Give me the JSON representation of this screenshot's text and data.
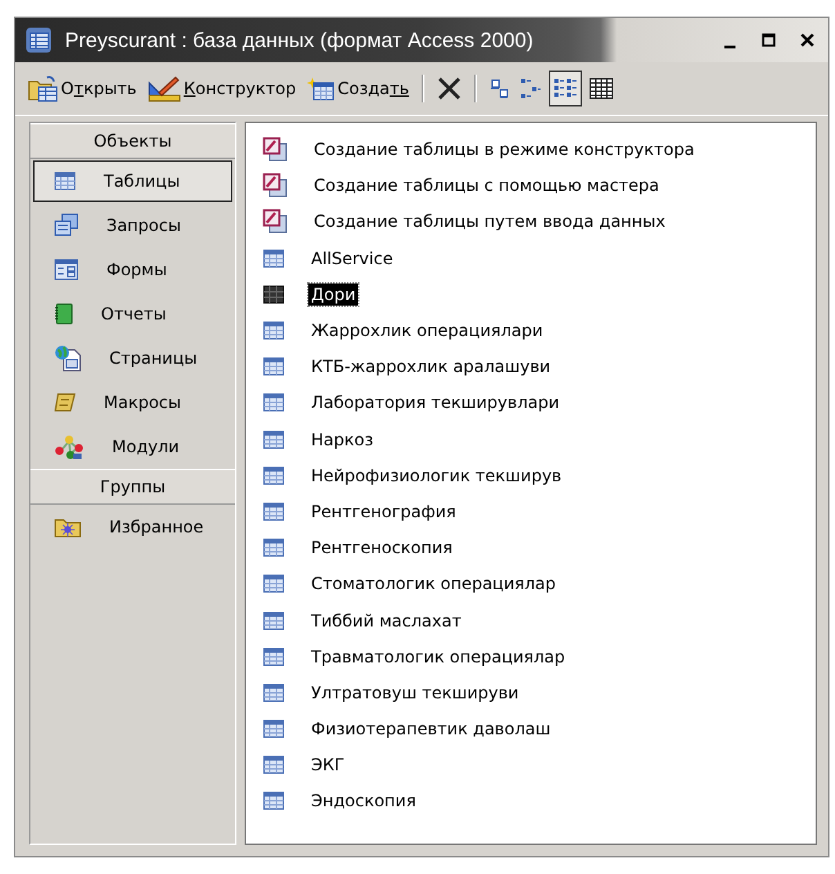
{
  "window": {
    "title": "Preyscurant : база данных (формат Access 2000)"
  },
  "toolbar": {
    "commands": [
      {
        "kind": "open",
        "before": "О",
        "accel": "т",
        "after": "крыть"
      },
      {
        "kind": "design",
        "accel": "К",
        "after": "онструктор"
      },
      {
        "kind": "new",
        "before": "Созда",
        "accel": "ть"
      }
    ],
    "views": [
      {
        "kind": "large",
        "selected": false
      },
      {
        "kind": "small",
        "selected": false
      },
      {
        "kind": "list",
        "selected": true
      },
      {
        "kind": "details",
        "selected": false
      }
    ]
  },
  "sidebar": {
    "sections": [
      {
        "title": "Объекты",
        "items": [
          {
            "kind": "table",
            "label": "Таблицы",
            "selected": true
          },
          {
            "kind": "query",
            "label": "Запросы",
            "selected": false
          },
          {
            "kind": "form",
            "label": "Формы",
            "selected": false
          },
          {
            "kind": "report",
            "label": "Отчеты",
            "selected": false
          },
          {
            "kind": "page",
            "label": "Страницы",
            "selected": false
          },
          {
            "kind": "macro",
            "label": "Макросы",
            "selected": false
          },
          {
            "kind": "module",
            "label": "Модули",
            "selected": false
          }
        ]
      },
      {
        "title": "Группы",
        "items": [
          {
            "kind": "favorites",
            "label": "Избранное",
            "selected": false
          }
        ]
      }
    ]
  },
  "objects": [
    {
      "kind": "wizard",
      "label": "Создание таблицы в режиме конструктора",
      "selected": false
    },
    {
      "kind": "wizard",
      "label": "Создание таблицы с помощью мастера",
      "selected": false
    },
    {
      "kind": "wizard",
      "label": "Создание таблицы путем ввода данных",
      "selected": false
    },
    {
      "kind": "table",
      "label": "AllService",
      "selected": false
    },
    {
      "kind": "table",
      "label": "Дори",
      "selected": true
    },
    {
      "kind": "table",
      "label": "Жаррохлик операциялари",
      "selected": false
    },
    {
      "kind": "table",
      "label": "КТБ-жаррохлик аралашуви",
      "selected": false
    },
    {
      "kind": "table",
      "label": "Лаборатория текширувлари",
      "selected": false
    },
    {
      "kind": "table",
      "label": "Наркоз",
      "selected": false
    },
    {
      "kind": "table",
      "label": "Нейрофизиологик текширув",
      "selected": false
    },
    {
      "kind": "table",
      "label": "Рентгенография",
      "selected": false
    },
    {
      "kind": "table",
      "label": "Рентгеноскопия",
      "selected": false
    },
    {
      "kind": "table",
      "label": "Стоматологик операциялар",
      "selected": false
    },
    {
      "kind": "table",
      "label": "Тиббий маслахат",
      "selected": false
    },
    {
      "kind": "table",
      "label": "Травматологик операциялар",
      "selected": false
    },
    {
      "kind": "table",
      "label": "Ултратовуш текшируви",
      "selected": false
    },
    {
      "kind": "table",
      "label": "Физиотерапевтик даволаш",
      "selected": false
    },
    {
      "kind": "table",
      "label": "ЭКГ",
      "selected": false
    },
    {
      "kind": "table",
      "label": "Эндоскопия",
      "selected": false
    }
  ]
}
